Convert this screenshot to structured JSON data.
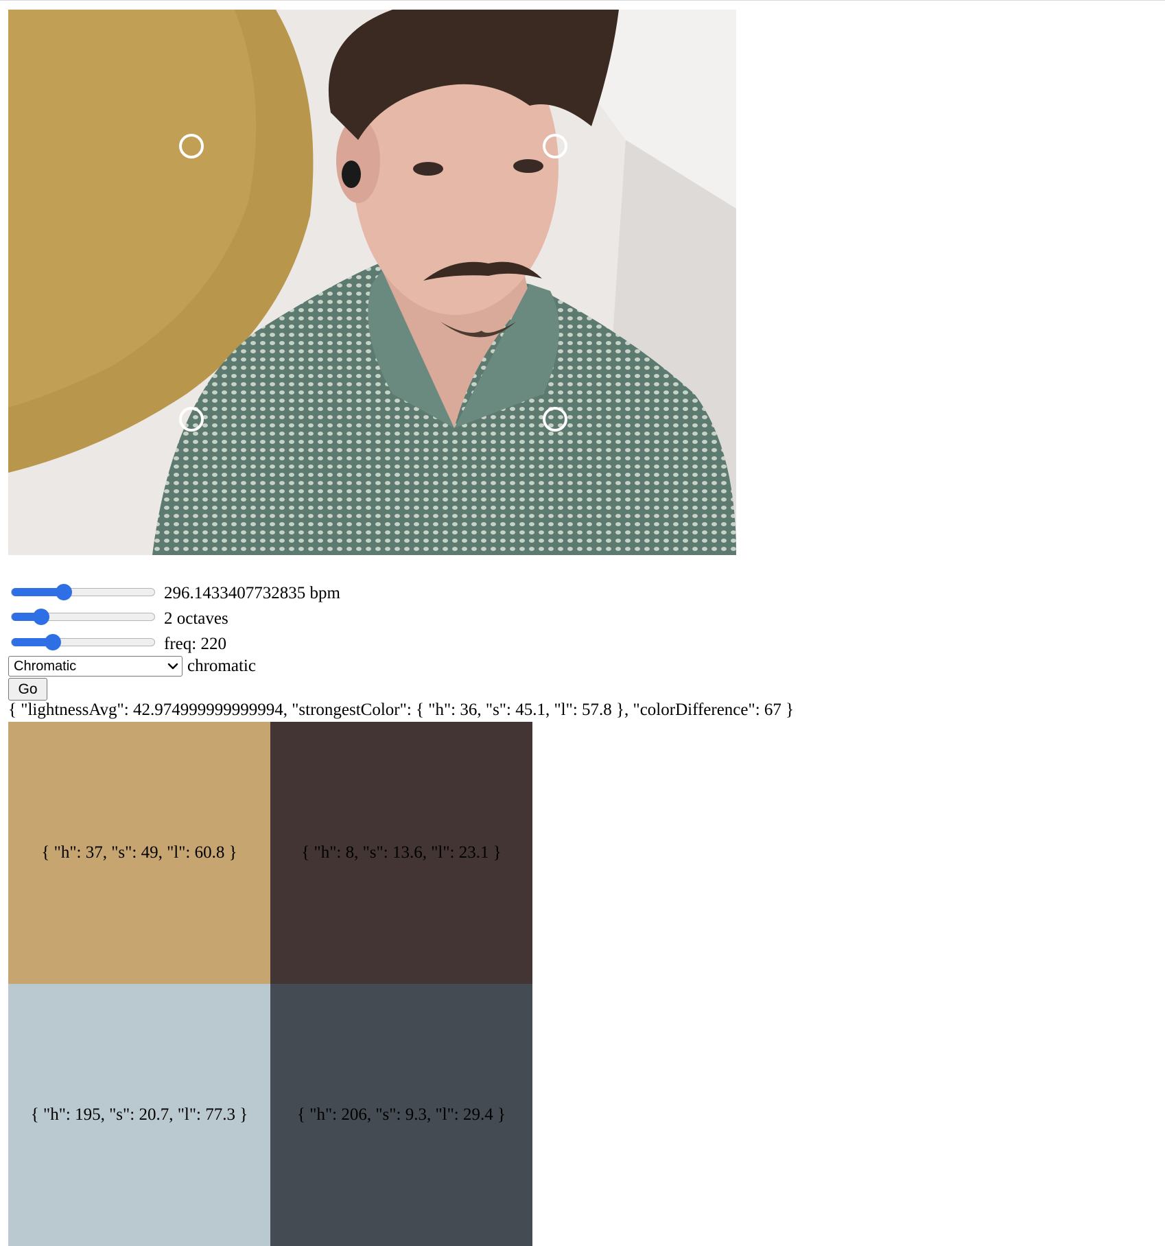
{
  "camera": {
    "description_icon": "webcam-feed",
    "markers": 4
  },
  "controls": {
    "tempo": {
      "label": "296.1433407732835 bpm",
      "fraction": 0.35
    },
    "octaves": {
      "label": "2 octaves",
      "fraction": 0.17
    },
    "frequency": {
      "label": "freq: 220",
      "fraction": 0.26
    },
    "scale_select": {
      "selected": "Chromatic"
    },
    "scale_label": "chromatic",
    "go_label": "Go"
  },
  "analysis_text": "{ \"lightnessAvg\": 42.974999999999994, \"strongestColor\": { \"h\": 36, \"s\": 45.1, \"l\": 57.8 }, \"colorDifference\": 67 }",
  "swatches": [
    {
      "label": "{ \"h\": 37, \"s\": 49, \"l\": 60.8 }",
      "color": "#c6a571"
    },
    {
      "label": "{ \"h\": 8, \"s\": 13.6, \"l\": 23.1 }",
      "color": "#433533"
    },
    {
      "label": "{ \"h\": 195, \"s\": 20.7, \"l\": 77.3 }",
      "color": "#bac9cf"
    },
    {
      "label": "{ \"h\": 206, \"s\": 9.3, \"l\": 29.4 }",
      "color": "#444b52"
    }
  ]
}
